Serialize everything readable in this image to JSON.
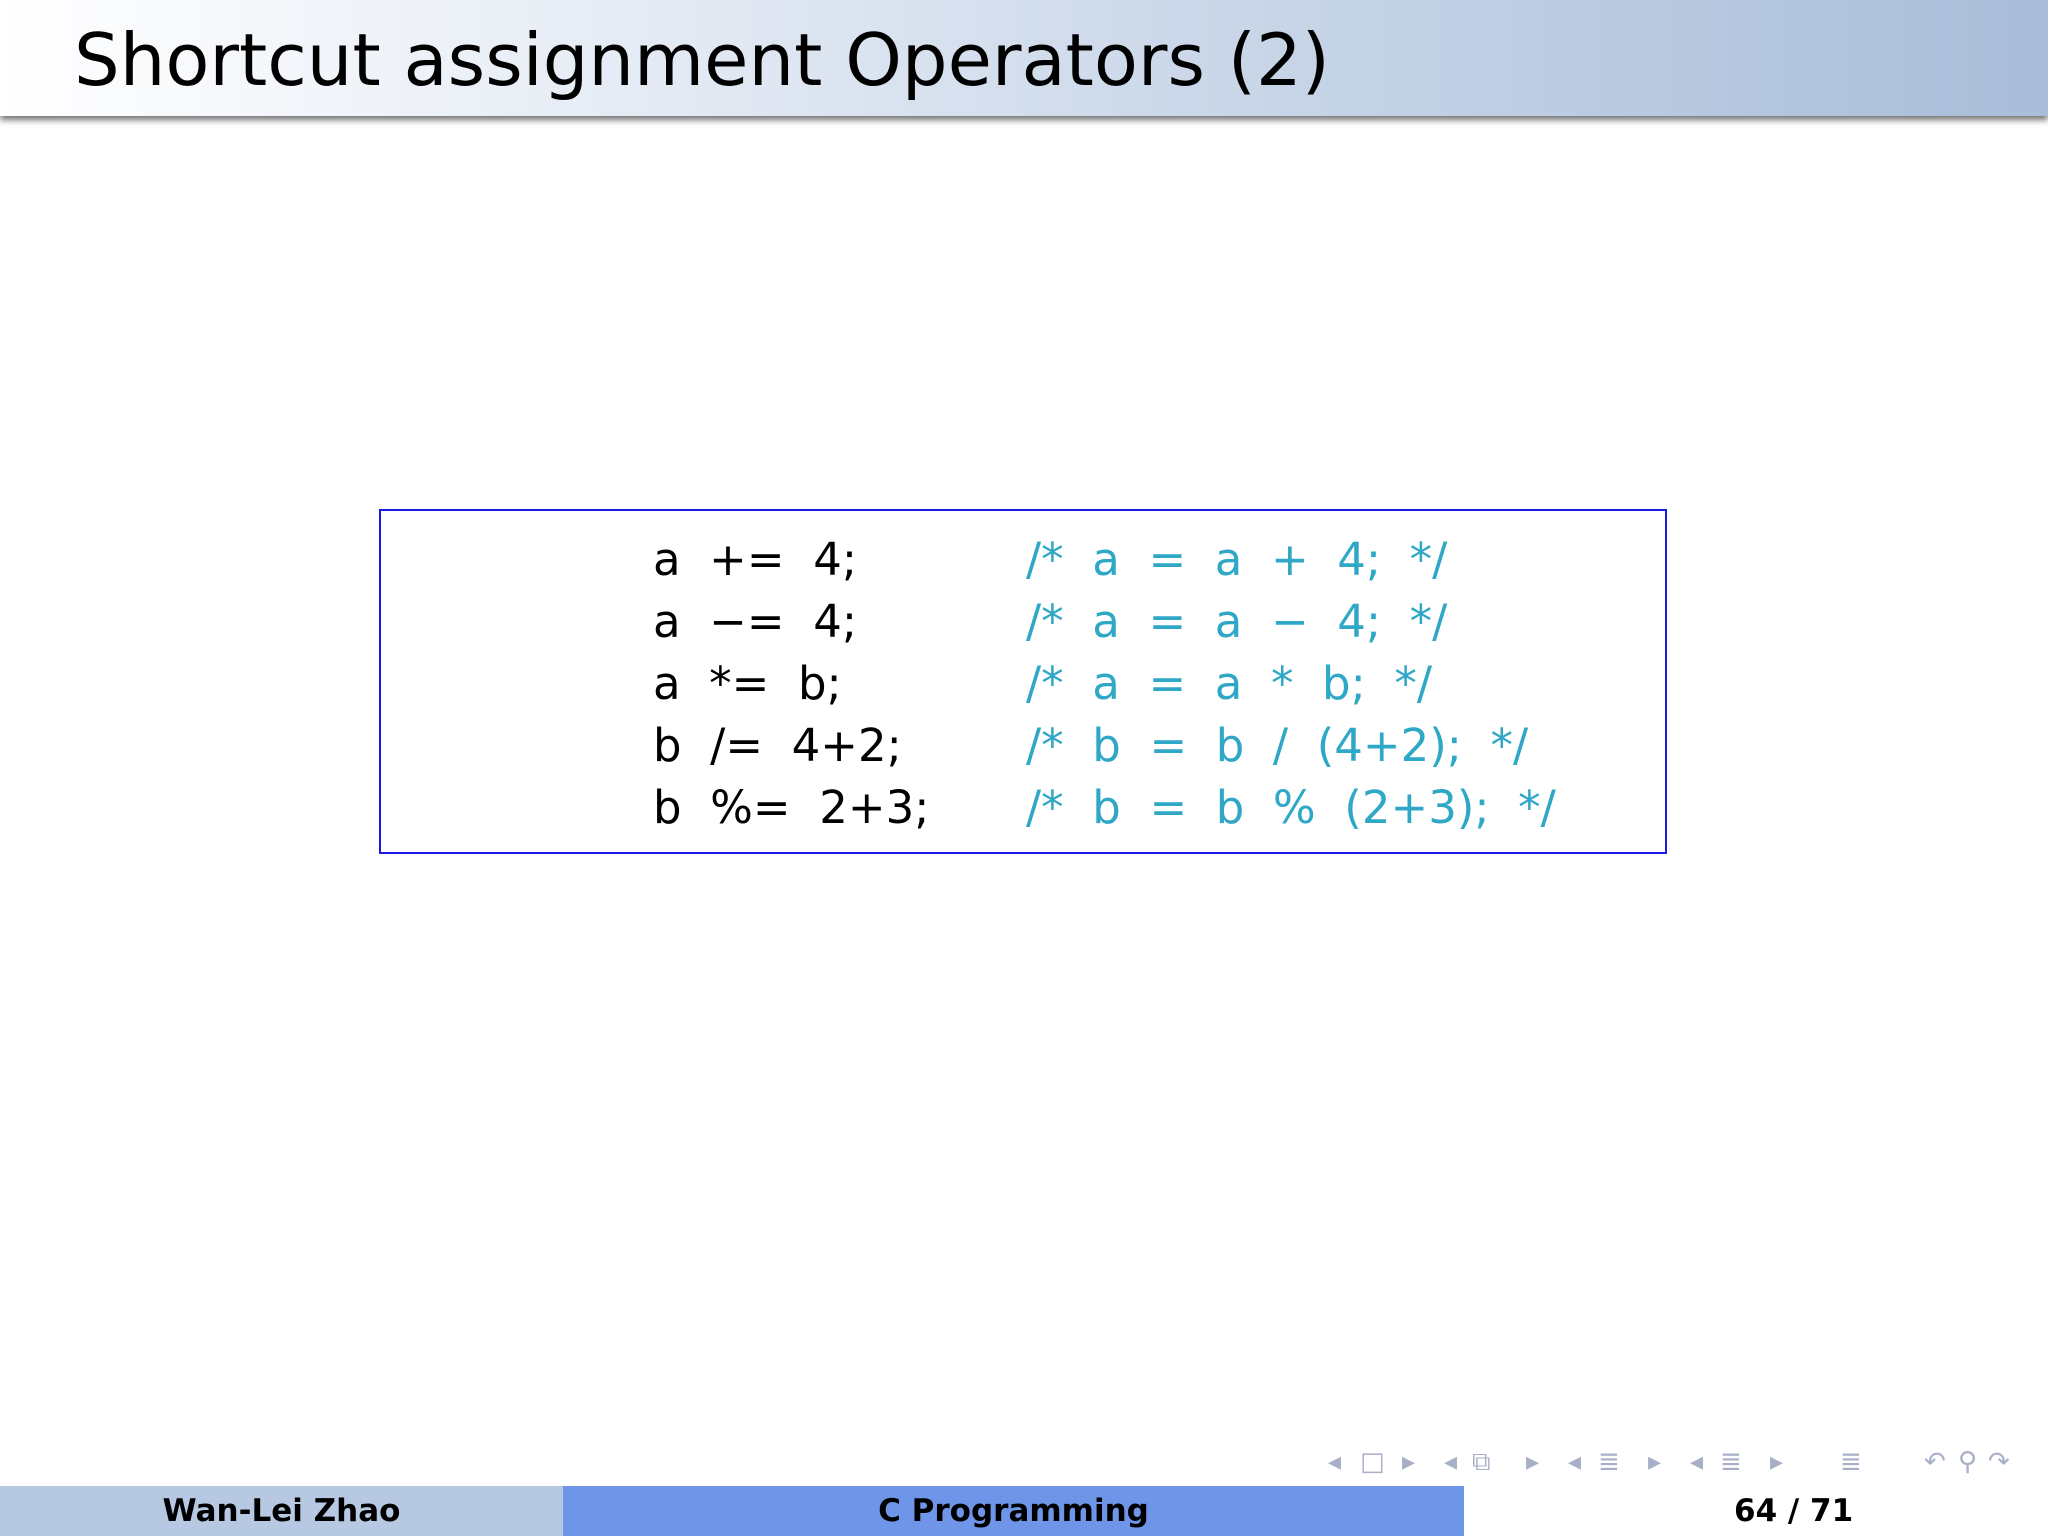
{
  "slide": {
    "title": "Shortcut assignment Operators (2)"
  },
  "code": {
    "lines": [
      {
        "stmt": "a  +=  4;",
        "comment": "/*  a  =  a  +  4;  */"
      },
      {
        "stmt": "a  −=  4;",
        "comment": "/*  a  =  a  −  4;  */"
      },
      {
        "stmt": "a  *=  b;",
        "comment": "/*  a  =  a  *  b;  */"
      },
      {
        "stmt": "b  /=  4+2;",
        "comment": "/*  b  =  b  /  (4+2);  */"
      },
      {
        "stmt": "b  %=  2+3;",
        "comment": "/*  b  =  b  %  (2+3);  */"
      }
    ],
    "comment_color": "#2fa7c6",
    "border_color": "#1a1ae6"
  },
  "navigation": {
    "icons": [
      "arrow-left-icon",
      "frame-icon",
      "arrow-right-icon",
      "arrow-left-icon",
      "subsection-icon",
      "arrow-right-icon",
      "arrow-left-icon",
      "section-icon",
      "arrow-right-icon",
      "arrow-left-icon",
      "align-icon",
      "arrow-right-icon",
      "align-icon",
      "undo-icon",
      "search-icon"
    ]
  },
  "footer": {
    "author": "Wan-Lei Zhao",
    "course": "C Programming",
    "page": "64 / 71"
  }
}
